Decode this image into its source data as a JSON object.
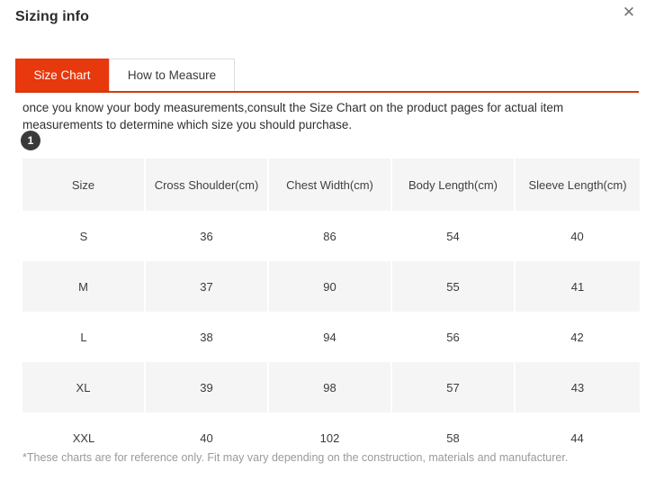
{
  "modal": {
    "title": "Sizing info",
    "close_icon": "close-icon",
    "close_glyph": "✕"
  },
  "tabs": [
    {
      "label": "Size Chart",
      "active": true
    },
    {
      "label": "How to Measure",
      "active": false
    }
  ],
  "description": "once you know your body measurements,consult the Size Chart on the product pages for actual item measurements to determine which size you should purchase.",
  "step_badge": "1",
  "table": {
    "headers": [
      "Size",
      "Cross Shoulder(cm)",
      "Chest Width(cm)",
      "Body Length(cm)",
      "Sleeve Length(cm)"
    ],
    "rows": [
      [
        "S",
        "36",
        "86",
        "54",
        "40"
      ],
      [
        "M",
        "37",
        "90",
        "55",
        "41"
      ],
      [
        "L",
        "38",
        "94",
        "56",
        "42"
      ],
      [
        "XL",
        "39",
        "98",
        "57",
        "43"
      ],
      [
        "XXL",
        "40",
        "102",
        "58",
        "44"
      ]
    ]
  },
  "footer_note": "*These charts are for reference only. Fit may vary depending on the construction, materials and manufacturer.",
  "colors": {
    "accent": "#e8380d",
    "accent_rule": "#d33a11",
    "stripe": "#f5f5f5",
    "badge": "#3a3a3a",
    "muted_text": "#9a9a9a"
  }
}
